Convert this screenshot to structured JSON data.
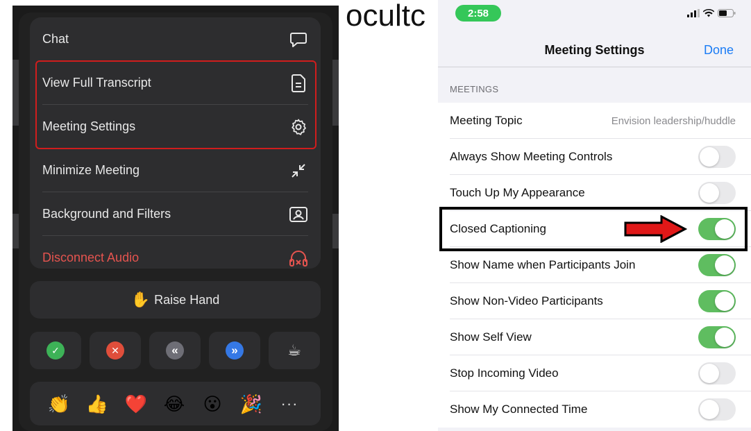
{
  "overlay_word": "ocultc",
  "zoom_menu": {
    "items": [
      {
        "label": "Chat",
        "icon": "chat-bubble-icon"
      },
      {
        "label": "View Full Transcript",
        "icon": "document-icon"
      },
      {
        "label": "Meeting Settings",
        "icon": "gear-icon"
      },
      {
        "label": "Minimize Meeting",
        "icon": "minimize-arrows-icon"
      },
      {
        "label": "Background and Filters",
        "icon": "person-frame-icon"
      },
      {
        "label": "Disconnect Audio",
        "icon": "headphones-x-icon"
      }
    ],
    "raise_hand": {
      "emoji": "✋",
      "label": "Raise Hand"
    },
    "feedback_buttons": [
      {
        "name": "yes",
        "symbol": "✓",
        "color": "#3db257"
      },
      {
        "name": "no",
        "symbol": "✕",
        "color": "#e04e3b"
      },
      {
        "name": "slower",
        "symbol": "«",
        "color": "#6e6e76"
      },
      {
        "name": "faster",
        "symbol": "»",
        "color": "#3578e5"
      },
      {
        "name": "coffee",
        "symbol": "☕",
        "color": "#2d2d2f"
      }
    ],
    "reactions": [
      "👏",
      "👍",
      "❤️",
      "😂",
      "😮",
      "🎉"
    ],
    "more_label": "···",
    "highlight_color": "#d11d1d"
  },
  "ios_settings": {
    "status_time": "2:58",
    "nav_title": "Meeting Settings",
    "done_label": "Done",
    "section_header": "MEETINGS",
    "meeting_topic": {
      "label": "Meeting Topic",
      "value": "Envision leadership/huddle"
    },
    "toggles": [
      {
        "label": "Always Show Meeting Controls",
        "on": false
      },
      {
        "label": "Touch Up My Appearance",
        "on": false
      },
      {
        "label": "Closed Captioning",
        "on": true
      },
      {
        "label": "Show Name when Participants Join",
        "on": true
      },
      {
        "label": "Show Non-Video Participants",
        "on": true
      },
      {
        "label": "Show Self View",
        "on": true
      },
      {
        "label": "Stop Incoming Video",
        "on": false
      },
      {
        "label": "Show My Connected Time",
        "on": false
      }
    ],
    "accent_color": "#1a7cf5",
    "toggle_on_color": "#5fbd60"
  }
}
